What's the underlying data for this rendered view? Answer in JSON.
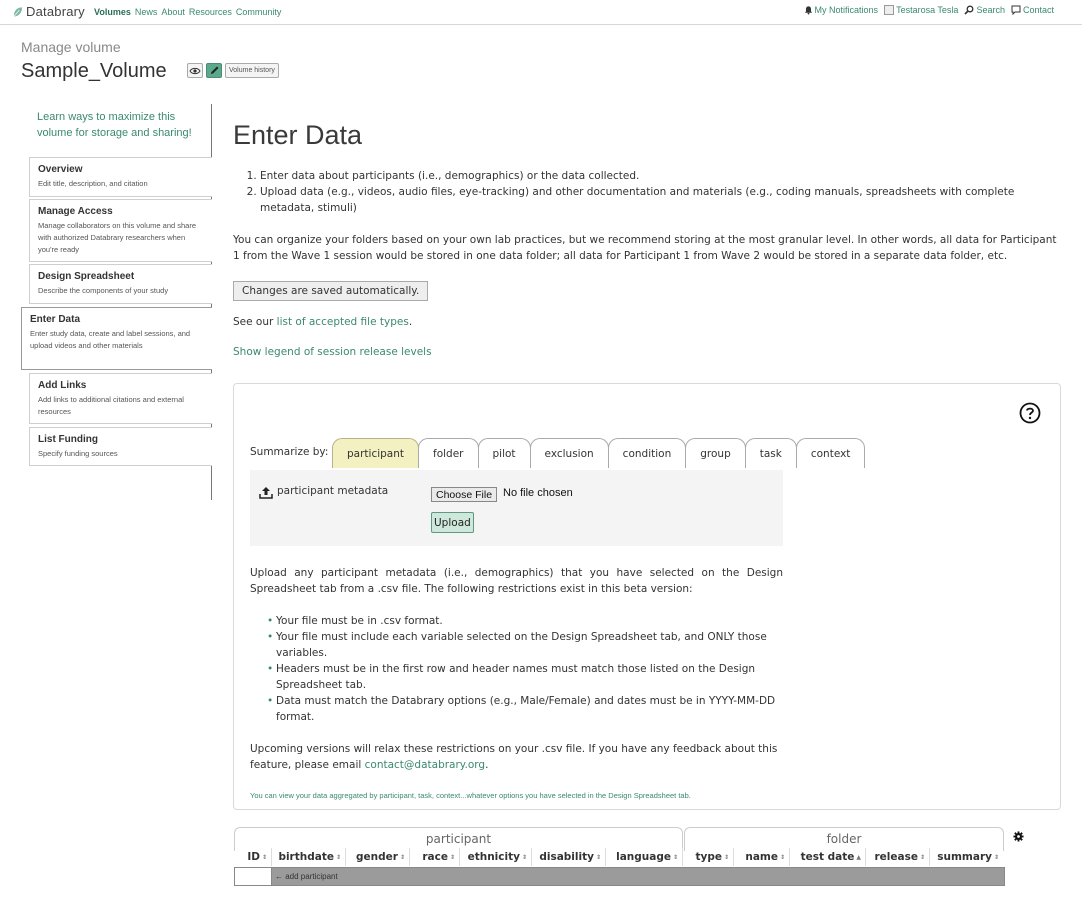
{
  "nav": {
    "brand": "Databrary",
    "links": [
      {
        "label": "Volumes",
        "active": true
      },
      {
        "label": "News",
        "active": false
      },
      {
        "label": "About",
        "active": false
      },
      {
        "label": "Resources",
        "active": false
      },
      {
        "label": "Community",
        "active": false
      }
    ],
    "notifications": "My Notifications",
    "user": "Testarosa Tesla",
    "search": "Search",
    "contact": "Contact"
  },
  "header": {
    "manage_label": "Manage volume",
    "volume_title": "Sample_Volume",
    "history_button": "Volume history"
  },
  "sidebar": {
    "learn_link": "Learn ways to maximize this volume for storage and sharing!",
    "items": [
      {
        "title": "Overview",
        "desc": "Edit title, description, and citation"
      },
      {
        "title": "Manage Access",
        "desc": "Manage collaborators on this volume and share with authorized Databrary researchers when you're ready"
      },
      {
        "title": "Design Spreadsheet",
        "desc": "Describe the components of your study"
      },
      {
        "title": "Enter Data",
        "desc": "Enter study data, create and label sessions, and upload videos and other materials"
      },
      {
        "title": "Add Links",
        "desc": "Add links to additional citations and external resources"
      },
      {
        "title": "List Funding",
        "desc": "Specify funding sources"
      }
    ]
  },
  "main": {
    "title": "Enter Data",
    "steps": [
      "Enter data about participants (i.e., demographics) or the data collected.",
      "Upload data (e.g., videos, audio files, eye-tracking) and other documentation and materials (e.g., coding manuals, spreadsheets with complete metadata, stimuli)"
    ],
    "organize_text": "You can organize your folders based on your own lab practices, but we recommend storing at the most granular level. In other words, all data for Participant 1 from the Wave 1 session would be stored in one data folder; all data for Participant 1 from Wave 2 would be stored in a separate data folder, etc.",
    "saved_button": "Changes are saved automatically.",
    "see_our_prefix": "See our ",
    "file_types_link": "list of accepted file types",
    "see_our_suffix": ".",
    "legend_link": "Show legend of session release levels"
  },
  "panel": {
    "summarize_label": "Summarize by:",
    "tabs": [
      "participant",
      "folder",
      "pilot",
      "exclusion",
      "condition",
      "group",
      "task",
      "context"
    ],
    "active_tab": "participant",
    "upload_label": "participant metadata",
    "choose_file": "Choose File",
    "no_file": "No file chosen",
    "upload_button": "Upload",
    "intro": "Upload any participant metadata (i.e., demographics) that you have selected on the Design Spreadsheet tab from a .csv file. The following restrictions exist in this beta version:",
    "rules": [
      "Your file must be in .csv format.",
      "Your file must include each variable selected on the Design Spreadsheet tab, and ONLY those variables.",
      "Headers must be in the first row and header names must match those listed on the Design Spreadsheet tab.",
      "Data must match the Databrary options (e.g., Male/Female) and dates must be in YYYY-MM-DD format."
    ],
    "upcoming_prefix": "Upcoming versions will relax these restrictions on your .csv file. If you have any feedback about this feature, please email ",
    "contact_email": "contact@databrary.org",
    "upcoming_suffix": ".",
    "note": "You can view your data aggregated by participant, task, context...whatever options you have selected in the Design Spreadsheet tab."
  },
  "table": {
    "group_participant": "participant",
    "group_folder": "folder",
    "columns": [
      {
        "label": "ID",
        "sort": "⇕"
      },
      {
        "label": "birthdate",
        "sort": "⇕"
      },
      {
        "label": "gender",
        "sort": "⇕"
      },
      {
        "label": "race",
        "sort": "⇕"
      },
      {
        "label": "ethnicity",
        "sort": "⇕"
      },
      {
        "label": "disability",
        "sort": "⇕"
      },
      {
        "label": "language",
        "sort": "⇕"
      },
      {
        "label": "type",
        "sort": "⇕"
      },
      {
        "label": "name",
        "sort": "⇕"
      },
      {
        "label": "test date",
        "sort": "▲"
      },
      {
        "label": "release",
        "sort": "⇕"
      },
      {
        "label": "summary",
        "sort": "⇕"
      }
    ],
    "add_participant": "← add participant"
  }
}
